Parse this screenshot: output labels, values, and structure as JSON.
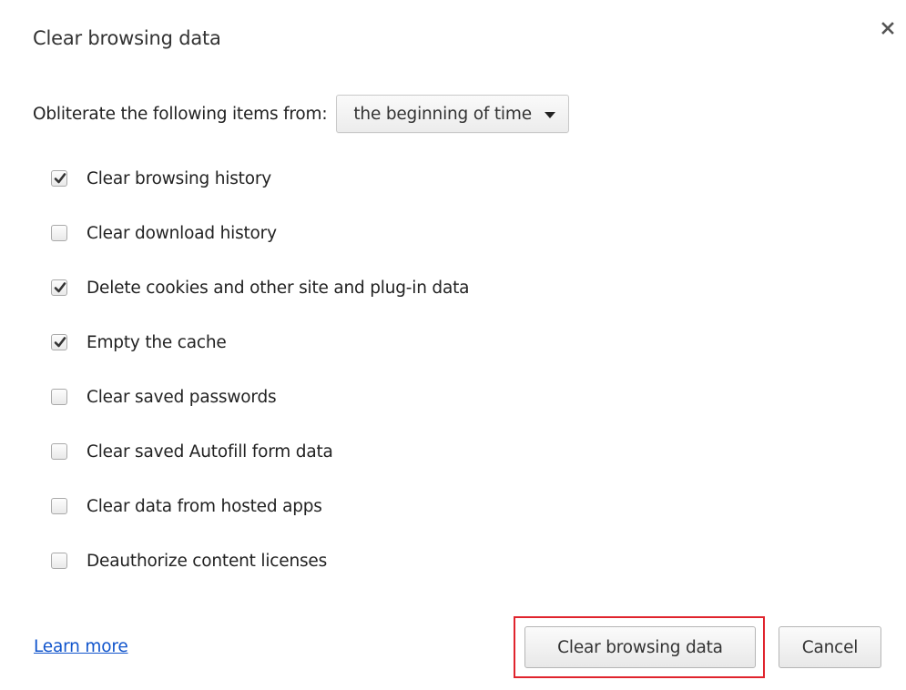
{
  "dialog": {
    "title": "Clear browsing data",
    "close_icon": "close-icon"
  },
  "range": {
    "label": "Obliterate the following items from:",
    "selected": "the beginning of time",
    "arrow_icon": "dropdown-arrow-icon"
  },
  "options": [
    {
      "label": "Clear browsing history",
      "checked": true
    },
    {
      "label": "Clear download history",
      "checked": false
    },
    {
      "label": "Delete cookies and other site and plug-in data",
      "checked": true
    },
    {
      "label": "Empty the cache",
      "checked": true
    },
    {
      "label": "Clear saved passwords",
      "checked": false
    },
    {
      "label": "Clear saved Autofill form data",
      "checked": false
    },
    {
      "label": "Clear data from hosted apps",
      "checked": false
    },
    {
      "label": "Deauthorize content licenses",
      "checked": false
    }
  ],
  "footer": {
    "learn_more": "Learn more",
    "clear_button": "Clear browsing data",
    "cancel_button": "Cancel"
  },
  "colors": {
    "link": "#1155cc",
    "highlight": "#e0242d",
    "text": "#222222"
  }
}
